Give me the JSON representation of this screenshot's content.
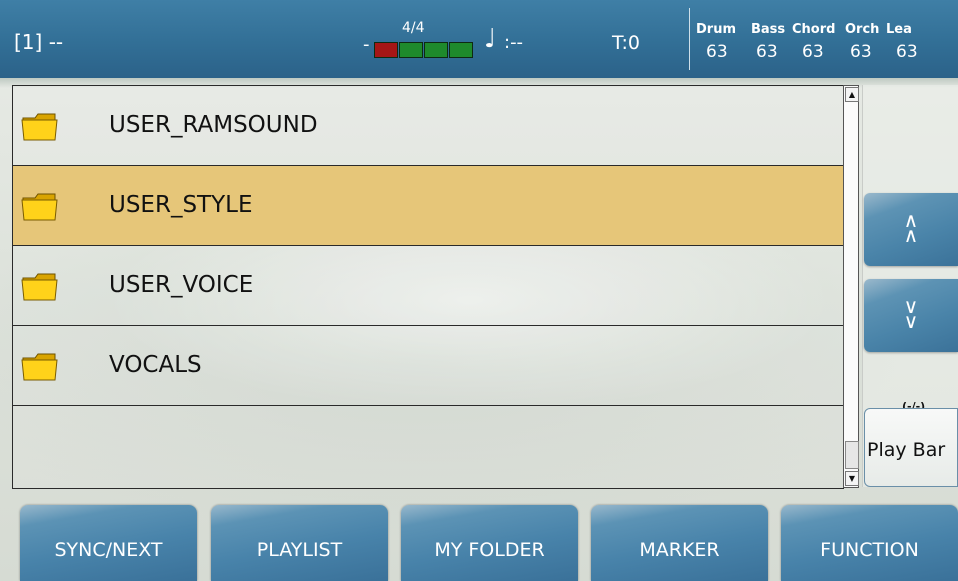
{
  "status_bar": {
    "song": "[1] --",
    "dash": "-",
    "time_signature": "4/4",
    "tempo": ":--",
    "transpose": "T:0",
    "mixer_labels": [
      "Drum",
      "Bass",
      "Chord",
      "Orch",
      "Lea"
    ],
    "mixer_values": [
      "63",
      "63",
      "63",
      "63",
      "63"
    ],
    "beat_colors": {
      "downbeat": "#a51616",
      "beat": "#1e8a2c"
    }
  },
  "list": {
    "items": [
      {
        "name": "USER_RAMSOUND",
        "icon": "folder-icon",
        "selected": false
      },
      {
        "name": "USER_STYLE",
        "icon": "folder-icon",
        "selected": true
      },
      {
        "name": "USER_VOICE",
        "icon": "folder-icon",
        "selected": false
      },
      {
        "name": "VOCALS",
        "icon": "folder-icon",
        "selected": false
      }
    ],
    "selected_color": "#e6c679"
  },
  "side": {
    "page_up": "^\n^",
    "page_down": "v\nv",
    "status": "(-/-)",
    "play_bar": "Play Bar"
  },
  "bottom": {
    "buttons": [
      "SYNC/NEXT",
      "PLAYLIST",
      "MY FOLDER",
      "MARKER",
      "FUNCTION"
    ]
  },
  "colors": {
    "accent": "#3a7199",
    "topbar": "#326f96"
  }
}
